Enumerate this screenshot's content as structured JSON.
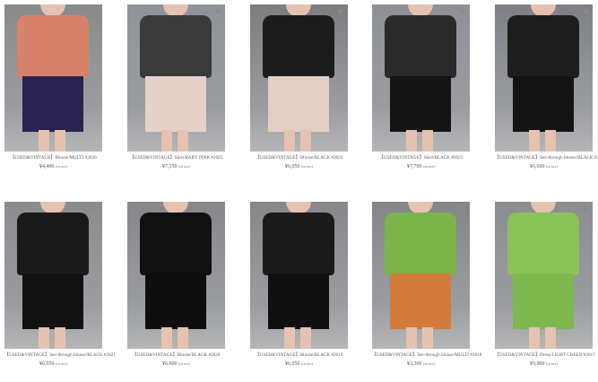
{
  "products": [
    {
      "title": "【USED&VINTAGE】Blouse/MULTI #2026",
      "price": "¥4,400",
      "tax": "(in tax)",
      "star_icon": "star-icon",
      "bg": "#8a8a8a",
      "top": "#d9826b",
      "bottom": "#2a2350",
      "skin": "#e6c2b0"
    },
    {
      "title": "【USED&VINTAGE】Skirt/BABY PINK #2025",
      "price": "¥7,150",
      "tax": "(in tax)",
      "star_icon": "star-icon",
      "bg": "#8f9399",
      "top": "#3a3a3a",
      "bottom": "#e6d2cb",
      "skin": "#e6c2b0"
    },
    {
      "title": "【USED&VINTAGE】Blouse/BLACK #2024",
      "price": "¥6,050",
      "tax": "(in tax)",
      "star_icon": "star-icon",
      "bg": "#7b7d80",
      "top": "#1c1c1c",
      "bottom": "#e4cfc7",
      "skin": "#e6c2b0"
    },
    {
      "title": "【USED&VINTAGE】Skirt/BLACK #2023",
      "price": "¥7,700",
      "tax": "(in tax)",
      "star_icon": "star-icon",
      "bg": "#8d9095",
      "top": "#2a2a2a",
      "bottom": "#141414",
      "skin": "#e6c2b0"
    },
    {
      "title": "【USED&VINTAGE】See-through blouse/BLACK #2022",
      "price": "¥6,600",
      "tax": "(in tax)",
      "star_icon": "star-icon",
      "bg": "#7d8085",
      "top": "#1e1e1e",
      "bottom": "#141414",
      "skin": "#e6c2b0"
    },
    {
      "title": "【USED&VINTAGE】See-through blouse/BLACK #2021",
      "price": "¥6,050",
      "tax": "(in tax)",
      "star_icon": "star-icon",
      "bg": "#8a8c90",
      "top": "#1a1a1a",
      "bottom": "#111111",
      "skin": "#e6c2b0"
    },
    {
      "title": "【USED&VINTAGE】Blouse/BLACK #2020",
      "price": "¥6,600",
      "tax": "(in tax)",
      "star_icon": "star-icon",
      "bg": "#85878b",
      "top": "#111111",
      "bottom": "#0e0e0e",
      "skin": "#e6c2b0"
    },
    {
      "title": "【USED&VINTAGE】Blouse/BLACK #2019",
      "price": "¥6,050",
      "tax": "(in tax)",
      "star_icon": "star-icon",
      "bg": "#86888c",
      "top": "#1b1b1b",
      "bottom": "#101010",
      "skin": "#e6c2b0"
    },
    {
      "title": "【USED&VINTAGE】See-through blouse/MULTI #2018",
      "price": "¥3,300",
      "tax": "(in tax)",
      "star_icon": "star-icon",
      "bg": "#84868a",
      "top": "#7bb34a",
      "bottom": "#d47a3a",
      "skin": "#e6c2b0"
    },
    {
      "title": "【USED&VINTAGE】Dress/LIGHT GREEN #2017",
      "price": "¥9,900",
      "tax": "(in tax)",
      "star_icon": "star-icon",
      "bg": "#8a8d91",
      "top": "#8cc25a",
      "bottom": "#7fb84e",
      "skin": "#e6c2b0"
    }
  ]
}
